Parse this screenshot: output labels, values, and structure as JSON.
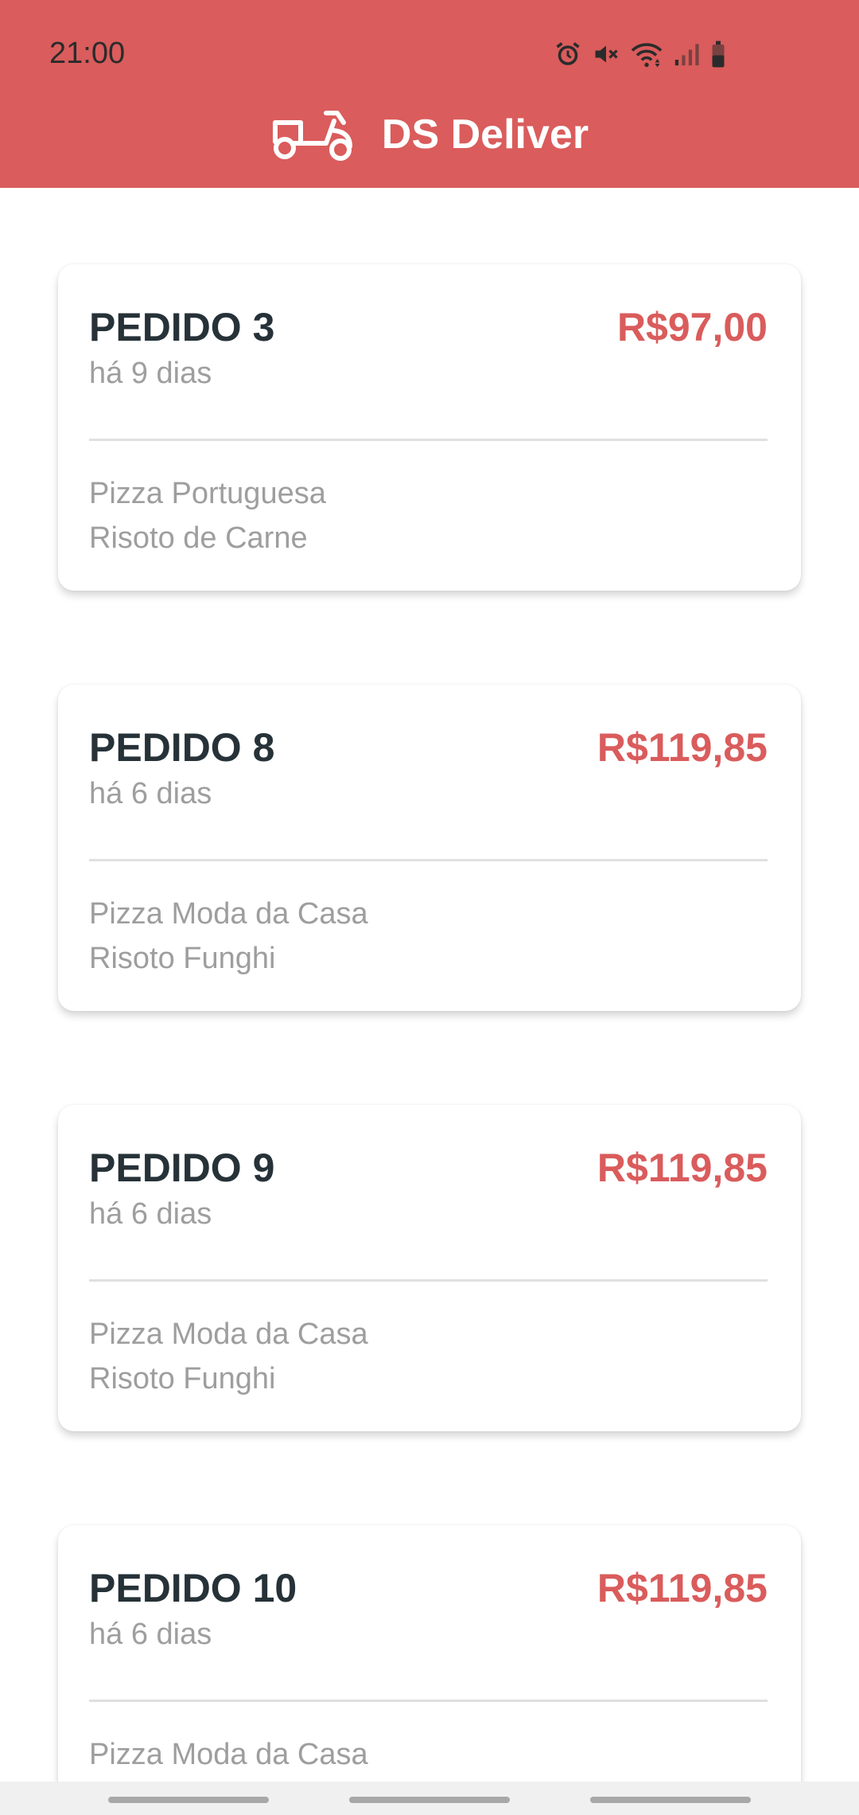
{
  "status_bar": {
    "time": "21:00",
    "icons": [
      "alarm-icon",
      "mute-icon",
      "wifi-icon",
      "signal-icon",
      "battery-icon"
    ]
  },
  "header": {
    "title": "DS Deliver",
    "logo_icon": "delivery-scooter-icon"
  },
  "colors": {
    "primary": "#DA5C5C",
    "title_text": "#263238",
    "secondary_text": "#9E9E9E",
    "background": "#FFFFFF"
  },
  "orders": [
    {
      "title": "PEDIDO 3",
      "date": "há 9 dias",
      "price": "R$97,00",
      "products": [
        "Pizza Portuguesa",
        "Risoto de Carne"
      ]
    },
    {
      "title": "PEDIDO 8",
      "date": "há 6 dias",
      "price": "R$119,85",
      "products": [
        "Pizza Moda da Casa",
        "Risoto Funghi"
      ]
    },
    {
      "title": "PEDIDO 9",
      "date": "há 6 dias",
      "price": "R$119,85",
      "products": [
        "Pizza Moda da Casa",
        "Risoto Funghi"
      ]
    },
    {
      "title": "PEDIDO 10",
      "date": "há 6 dias",
      "price": "R$119,85",
      "products": [
        "Pizza Moda da Casa"
      ]
    }
  ],
  "nav_bar": {
    "buttons": [
      "recent-apps-button",
      "home-button",
      "back-button"
    ]
  }
}
